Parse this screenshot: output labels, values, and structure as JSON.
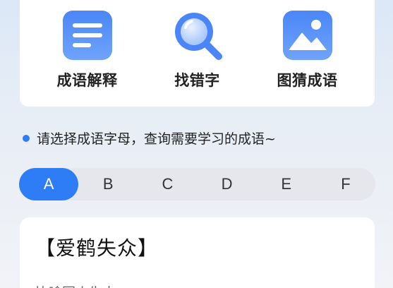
{
  "features": [
    {
      "label": "成语解释",
      "icon": "document-icon"
    },
    {
      "label": "找错字",
      "icon": "magnifier-icon"
    },
    {
      "label": "图猜成语",
      "icon": "image-icon"
    }
  ],
  "tip": {
    "text": "请选择成语字母，查询需要学习的成语~"
  },
  "letters": [
    "A",
    "B",
    "C",
    "D",
    "E",
    "F"
  ],
  "selected_letter": "A",
  "idiom": {
    "title": "【爱鹤失众】",
    "description": "比喻因小失大。"
  },
  "colors": {
    "accent": "#2f7df6",
    "tab_bg": "#e5e7ec"
  }
}
